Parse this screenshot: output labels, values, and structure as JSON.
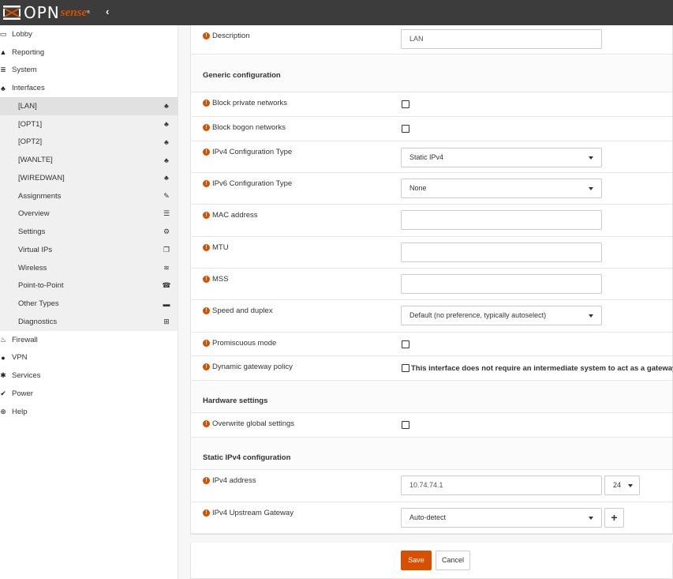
{
  "brand": {
    "opn": "OPN",
    "sense": "sense",
    "tm": "®",
    "collapse_glyph": "‹"
  },
  "sidebar": {
    "items": [
      {
        "label": "Lobby",
        "icon": "lobby-icon",
        "glyph": "▭"
      },
      {
        "label": "Reporting",
        "icon": "reporting-icon",
        "glyph": "▲"
      },
      {
        "label": "System",
        "icon": "system-icon",
        "glyph": "≣"
      },
      {
        "label": "Interfaces",
        "icon": "interfaces-icon",
        "glyph": "♣"
      }
    ],
    "interface_items": [
      {
        "label": "[LAN]",
        "icon": "sitemap-icon",
        "glyph": "♣"
      },
      {
        "label": "[OPT1]",
        "icon": "sitemap-icon",
        "glyph": "♣"
      },
      {
        "label": "[OPT2]",
        "icon": "sitemap-icon",
        "glyph": "♣"
      },
      {
        "label": "[WANLTE]",
        "icon": "sitemap-icon",
        "glyph": "♣"
      },
      {
        "label": "[WIREDWAN]",
        "icon": "sitemap-icon",
        "glyph": "♣"
      },
      {
        "label": "Assignments",
        "icon": "pencil-icon",
        "glyph": "✎"
      },
      {
        "label": "Overview",
        "icon": "list-icon",
        "glyph": "☰"
      },
      {
        "label": "Settings",
        "icon": "cogs-icon",
        "glyph": "⚙"
      },
      {
        "label": "Virtual IPs",
        "icon": "copy-icon",
        "glyph": "❐"
      },
      {
        "label": "Wireless",
        "icon": "wifi-icon",
        "glyph": "≋"
      },
      {
        "label": "Point-to-Point",
        "icon": "phone-icon",
        "glyph": "☎"
      },
      {
        "label": "Other Types",
        "icon": "archive-icon",
        "glyph": "▬"
      },
      {
        "label": "Diagnostics",
        "icon": "medkit-icon",
        "glyph": "⊞"
      }
    ],
    "bottom_items": [
      {
        "label": "Firewall",
        "icon": "fire-icon",
        "glyph": "♨"
      },
      {
        "label": "VPN",
        "icon": "globe-icon",
        "glyph": "●"
      },
      {
        "label": "Services",
        "icon": "cog-icon",
        "glyph": "✱"
      },
      {
        "label": "Power",
        "icon": "plug-icon",
        "glyph": "✔"
      },
      {
        "label": "Help",
        "icon": "support-icon",
        "glyph": "⊕"
      }
    ]
  },
  "form": {
    "description": {
      "label": "Description",
      "value": "LAN"
    },
    "generic_section": "Generic configuration",
    "block_private": {
      "label": "Block private networks"
    },
    "block_bogon": {
      "label": "Block bogon networks"
    },
    "ipv4_type": {
      "label": "IPv4 Configuration Type",
      "value": "Static IPv4"
    },
    "ipv6_type": {
      "label": "IPv6 Configuration Type",
      "value": "None"
    },
    "mac": {
      "label": "MAC address",
      "value": ""
    },
    "mtu": {
      "label": "MTU",
      "value": ""
    },
    "mss": {
      "label": "MSS",
      "value": ""
    },
    "speed": {
      "label": "Speed and duplex",
      "value": "Default (no preference, typically autoselect)"
    },
    "promisc": {
      "label": "Promiscuous mode"
    },
    "dyn_gw": {
      "label": "Dynamic gateway policy",
      "text": "This interface does not require an intermediate system to act as a gateway"
    },
    "hardware_section": "Hardware settings",
    "overwrite": {
      "label": "Overwrite global settings"
    },
    "static_section": "Static IPv4 configuration",
    "ipv4_addr": {
      "label": "IPv4 address",
      "value": "10.74.74.1",
      "cidr": "24"
    },
    "upstream_gw": {
      "label": "IPv4 Upstream Gateway",
      "value": "Auto-detect",
      "add_glyph": "+"
    },
    "save_label": "Save",
    "cancel_label": "Cancel",
    "info_glyph": "!"
  },
  "colors": {
    "accent": "#d94f00",
    "topbar": "#3c3c3c"
  }
}
